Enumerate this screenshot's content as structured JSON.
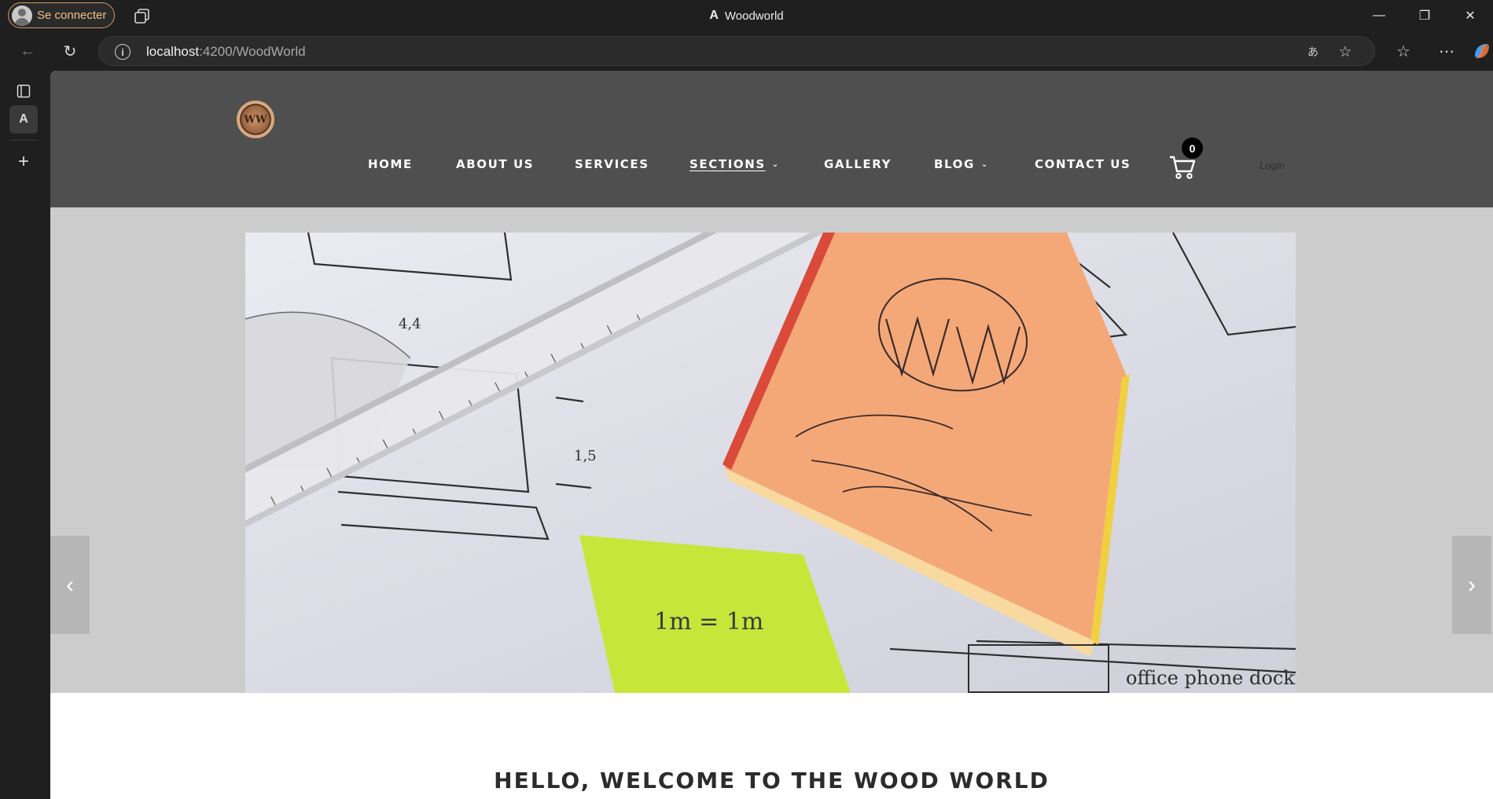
{
  "browser": {
    "profile_label": "Se connecter",
    "window_title": "Woodworld",
    "url_host": "localhost",
    "url_path": ":4200/WoodWorld",
    "controls": {
      "minimize": "—",
      "restore": "❐",
      "close": "✕"
    }
  },
  "site": {
    "logo_text": "WW",
    "nav": [
      {
        "label": "HOME",
        "has_caret": false,
        "current": false
      },
      {
        "label": "ABOUT US",
        "has_caret": false,
        "current": false
      },
      {
        "label": "SERVICES",
        "has_caret": false,
        "current": false
      },
      {
        "label": "SECTIONS",
        "has_caret": true,
        "current": true
      },
      {
        "label": "GALLERY",
        "has_caret": false,
        "current": false
      },
      {
        "label": "BLOG",
        "has_caret": true,
        "current": false
      },
      {
        "label": "CONTACT US",
        "has_caret": false,
        "current": false
      }
    ],
    "cart_count": "0",
    "login_label": "Login",
    "hero": {
      "note_text": "1m = 1m",
      "ruler_labels": [
        "4,4",
        "1,5",
        "1,5"
      ],
      "sticky_scribble": "WW wood world",
      "table_text": "office phone docki",
      "arrow_prev": "‹",
      "arrow_next": "›"
    },
    "welcome_title": "HELLO, WELCOME TO THE WOOD WORLD"
  },
  "colors": {
    "header_bg": "#4f4f4f",
    "hero_bg": "#cccccc",
    "profile_accent": "#d39a60",
    "sticky_orange": "#f4a878",
    "sticky_green": "#c8e63a"
  }
}
